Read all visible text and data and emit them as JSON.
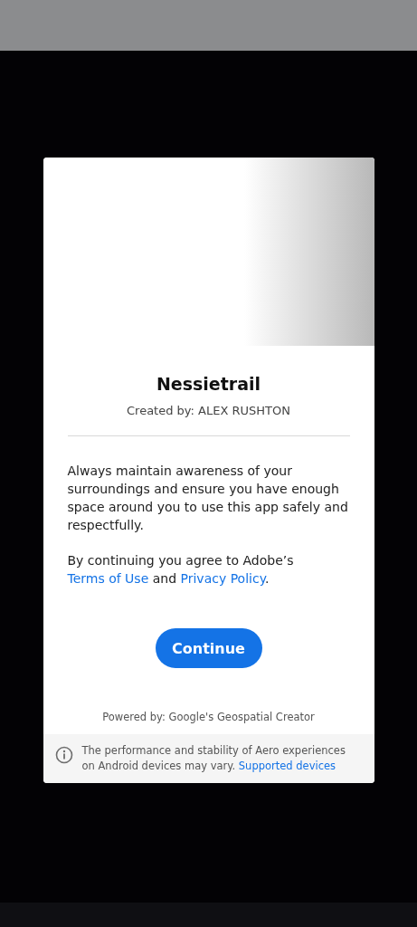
{
  "title": "Nessietrail",
  "creator": "Created by: ALEX RUSHTON",
  "safety_text": "Always maintain awareness of your surroundings and ensure you have enough space around you to use this app safely and respectfully.",
  "agreement": [
    {
      "kind": "text",
      "text": "By continuing you agree to Adobe’s "
    },
    {
      "kind": "link",
      "text": "Terms of Use"
    },
    {
      "kind": "text",
      "text": " and "
    },
    {
      "kind": "link",
      "text": "Privacy Policy"
    },
    {
      "kind": "text",
      "text": "."
    }
  ],
  "continue_button": "Continue",
  "powered_by": "Powered by: Google's Geospatial Creator",
  "notice": [
    {
      "kind": "text",
      "text": "The performance and stability of Aero experiences on Android devices may vary. "
    },
    {
      "kind": "link",
      "text": "Supported devices"
    }
  ]
}
